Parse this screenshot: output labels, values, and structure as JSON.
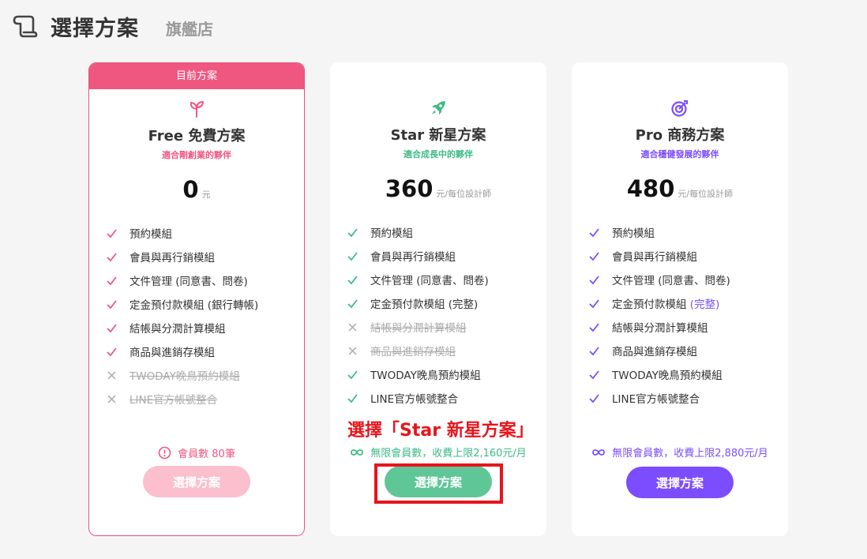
{
  "header": {
    "title": "選擇方案",
    "subtitle": "旗艦店"
  },
  "colors": {
    "free": "#ef5781",
    "star": "#3dbb86",
    "pro": "#7c4dff",
    "annotation": "#e8141b"
  },
  "plans": [
    {
      "banner": "目前方案",
      "icon": "sprout-icon",
      "name": "Free 免費方案",
      "tagline": "適合剛創業的夥伴",
      "price": "0",
      "price_unit": "元",
      "features": [
        {
          "label": "預約模組",
          "enabled": true
        },
        {
          "label": "會員與再行銷模組",
          "enabled": true
        },
        {
          "label": "文件管理 (同意書、問卷)",
          "enabled": true
        },
        {
          "label": "定金預付款模組 (銀行轉帳)",
          "enabled": true
        },
        {
          "label": "結帳與分潤計算模組",
          "enabled": true
        },
        {
          "label": "商品與進銷存模組",
          "enabled": true
        },
        {
          "label": "TWODAY晚鳥預約模組",
          "enabled": false
        },
        {
          "label": "LINE官方帳號整合",
          "enabled": false
        }
      ],
      "quota": "會員數 80筆",
      "button": "選擇方案"
    },
    {
      "icon": "rocket-icon",
      "name": "Star 新星方案",
      "tagline": "適合成長中的夥伴",
      "price": "360",
      "price_unit": "元/每位設計師",
      "features": [
        {
          "label": "預約模組",
          "enabled": true
        },
        {
          "label": "會員與再行銷模組",
          "enabled": true
        },
        {
          "label": "文件管理 (同意書、問卷)",
          "enabled": true
        },
        {
          "label": "定金預付款模組 (完整)",
          "enabled": true
        },
        {
          "label": "結帳與分潤計算模組",
          "enabled": false
        },
        {
          "label": "商品與進銷存模組",
          "enabled": false
        },
        {
          "label": "TWODAY晚鳥預約模組",
          "enabled": true
        },
        {
          "label": "LINE官方帳號整合",
          "enabled": true
        }
      ],
      "quota": "無限會員數，收費上限2,160元/月",
      "button": "選擇方案"
    },
    {
      "icon": "target-icon",
      "name": "Pro 商務方案",
      "tagline": "適合穩健發展的夥伴",
      "price": "480",
      "price_unit": "元/每位設計師",
      "features": [
        {
          "label": "預約模組",
          "enabled": true
        },
        {
          "label": "會員與再行銷模組",
          "enabled": true
        },
        {
          "label": "文件管理 (同意書、問卷)",
          "enabled": true
        },
        {
          "label": "定金預付款模組",
          "highlight": "(完整)",
          "enabled": true
        },
        {
          "label": "結帳與分潤計算模組",
          "enabled": true
        },
        {
          "label": "商品與進銷存模組",
          "enabled": true
        },
        {
          "label": "TWODAY晚鳥預約模組",
          "enabled": true
        },
        {
          "label": "LINE官方帳號整合",
          "enabled": true
        }
      ],
      "quota": "無限會員數，收費上限2,880元/月",
      "button": "選擇方案"
    }
  ],
  "annotation": {
    "text": "選擇「Star 新星方案」"
  }
}
